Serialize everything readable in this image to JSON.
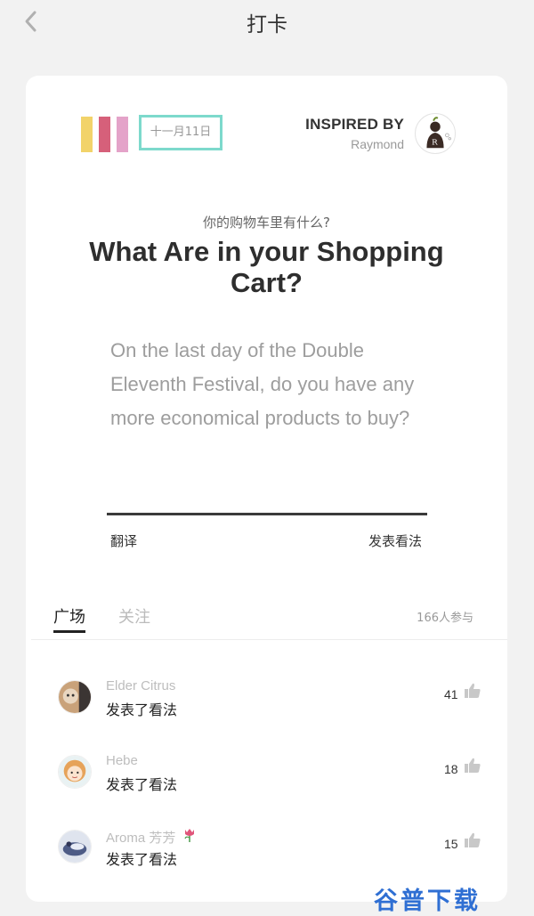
{
  "nav": {
    "title": "打卡",
    "back_icon": "chevron-left-icon"
  },
  "card": {
    "stripe_colors": [
      "#f2d36a",
      "#d6607a",
      "#e4a3c9"
    ],
    "date": "十一月11日",
    "inspired_label": "INSPIRED BY",
    "inspired_name": "Raymond",
    "question_cn": "你的购物车里有什么?",
    "question_en": "What Are in your Shopping Cart?",
    "description": "On the last day of the Double Eleventh Festival, do you have any more economical products to buy?",
    "translate_label": "翻译",
    "post_label": "发表看法"
  },
  "tabs": {
    "items": [
      {
        "label": "广场",
        "active": true
      },
      {
        "label": "关注",
        "active": false
      }
    ],
    "participants": "166人参与"
  },
  "feed": [
    {
      "name": "Elder Citrus",
      "action": "发表了看法",
      "likes": "41"
    },
    {
      "name": "Hebe",
      "action": "发表了看法",
      "likes": "18"
    },
    {
      "name": "Aroma 芳芳",
      "action": "发表了看法",
      "likes": "15"
    }
  ],
  "watermark": "谷普下载"
}
